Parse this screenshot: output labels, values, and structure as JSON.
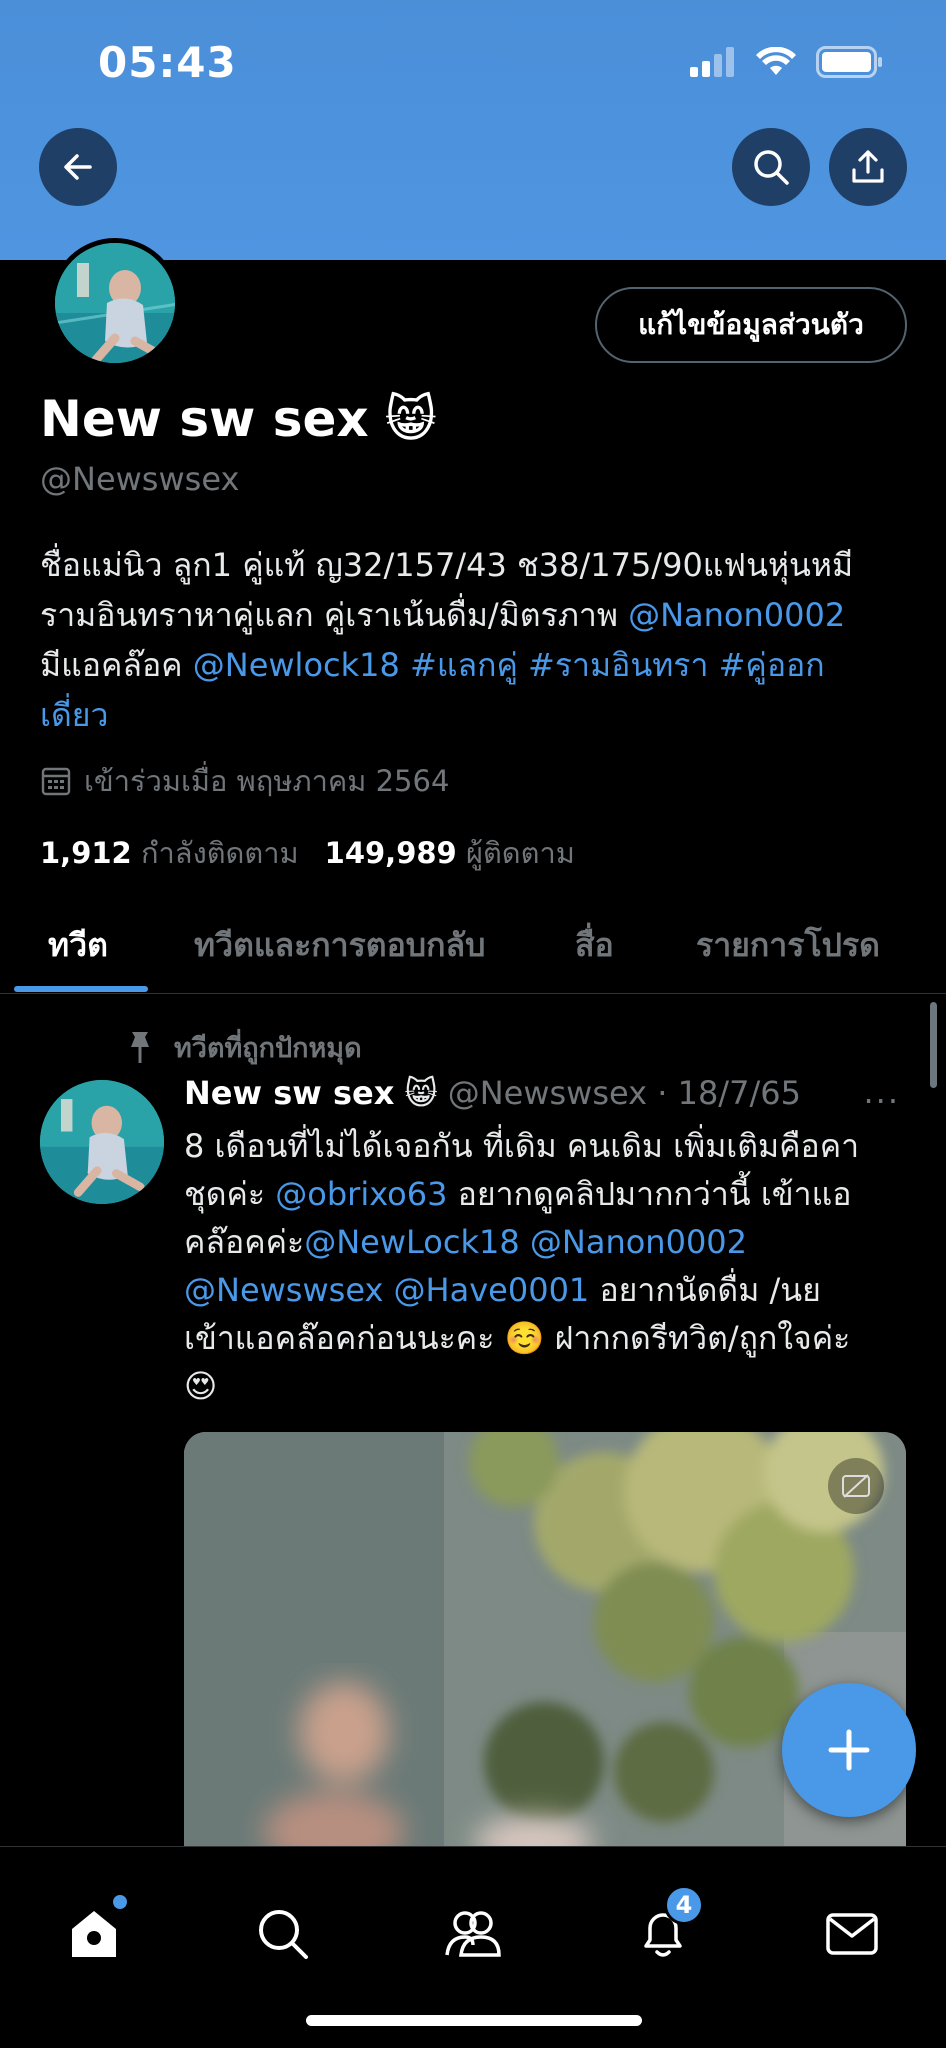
{
  "status_bar": {
    "time": "05:43"
  },
  "header": {
    "back_icon": "arrow-left-icon",
    "search_icon": "search-icon",
    "share_icon": "share-icon"
  },
  "profile": {
    "edit_label": "แก้ไขข้อมูลส่วนตัว",
    "display_name": "New sw sex",
    "emoji": "😸",
    "handle": "@Newswsex",
    "bio_line1": "ชื่อแม่นิว ลูก1 คู่แท้ ญ32/157/43 ช38/175/90แฟนหุ่นหมี",
    "bio_line2_text": "รามอินทราหาคู่แลก คู่เราเน้นดื่ม/มิตรภาพ ",
    "bio_line2_link": "@Nanon0002",
    "bio_line3_text": "มีแอคล๊อค ",
    "bio_line3_links": "@Newlock18 #แลกคู่ #รามอินทรา #คู่ออก",
    "bio_line4_link": "เดี่ยว",
    "joined": "เข้าร่วมเมื่อ พฤษภาคม 2564",
    "following_count": "1,912",
    "following_label": "กำลังติดตาม",
    "followers_count": "149,989",
    "followers_label": "ผู้ติดตาม"
  },
  "tabs": [
    "ทวีต",
    "ทวีตและการตอบกลับ",
    "สื่อ",
    "รายการโปรด"
  ],
  "tweet": {
    "pinned_label": "ทวีตที่ถูกปักหมุด",
    "name": "New sw sex",
    "emoji": "😸",
    "handle_date": "@Newswsex · 18/7/65",
    "more": "···",
    "line1": "8 เดือนที่ไม่ได้เจอกัน ที่เดิม คนเดิม เพิ่มเติมคือคา",
    "line2_a": "ชุดค่ะ ",
    "line2_link": "@obrixo63",
    "line2_b": " อยากดูคลิปมากกว่านี้ เข้าแอ",
    "line3_a": "คล๊อคค่ะ",
    "line3_link": "@NewLock18  @Nanon0002",
    "line4_link": "@Newswsex @Have0001",
    "line4_b": " อยากนัดดื่ม /นย",
    "line5": "เข้าแอคล๊อคก่อนนะคะ ☺️ ฝากกดรีทวิต/ถูกใจค่ะ",
    "line6": "😍"
  },
  "nav": {
    "notifications_badge": "4"
  }
}
